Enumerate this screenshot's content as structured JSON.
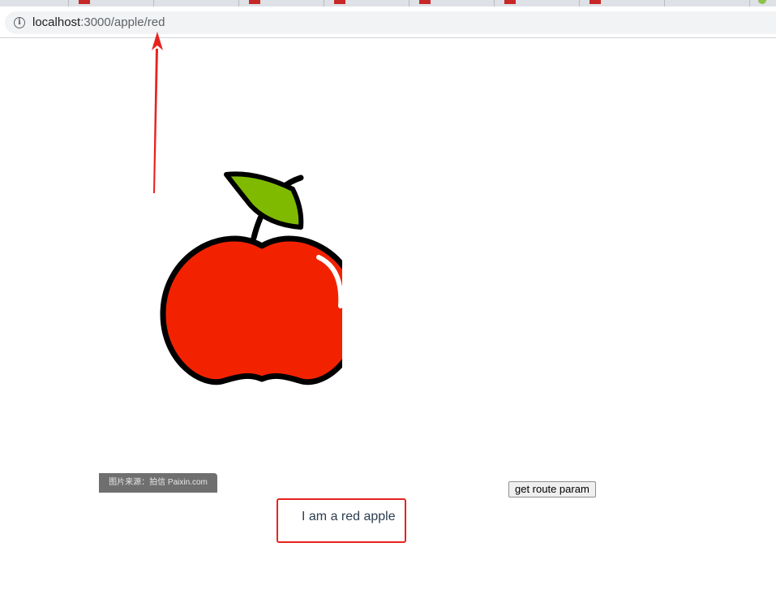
{
  "browser": {
    "url_host": "localhost",
    "url_path": ":3000/apple/red"
  },
  "page": {
    "watermark_text": "图片来源：拍信 Paixin.com",
    "route_button_label": "get route param",
    "apple_message": "I am a red apple"
  },
  "colors": {
    "apple_red": "#f22200",
    "leaf_green": "#7fba00",
    "annotation_red": "#e8231f"
  },
  "icons": {
    "address_bar": "info-icon"
  }
}
